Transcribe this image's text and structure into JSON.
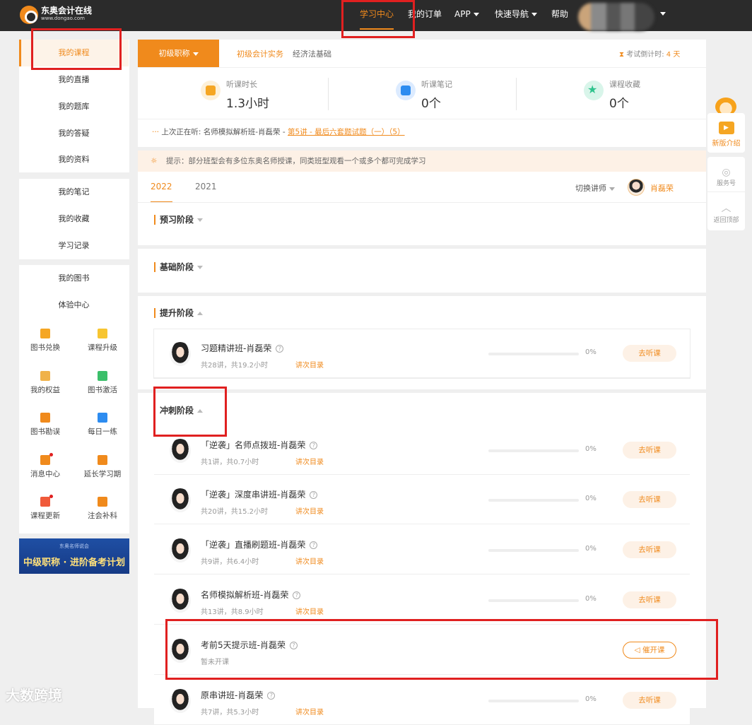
{
  "brand": {
    "name": "东奥会计在线",
    "url": "www.dongao.com"
  },
  "topnav": {
    "items": [
      "学习中心",
      "我的订单",
      "APP",
      "快速导航",
      "帮助"
    ]
  },
  "sidebar": {
    "group1": [
      "我的课程",
      "我的直播",
      "我的题库",
      "我的答疑",
      "我的资料"
    ],
    "group2": [
      "我的笔记",
      "我的收藏",
      "学习记录"
    ],
    "group3": [
      "我的图书",
      "体验中心"
    ],
    "grid": [
      {
        "label": "图书兑换",
        "icon": "exchange-icon",
        "color": "#f5a623"
      },
      {
        "label": "课程升级",
        "icon": "upgrade-icon",
        "color": "#f7c531"
      },
      {
        "label": "我的权益",
        "icon": "crown-icon",
        "color": "#f0b24a"
      },
      {
        "label": "图书激活",
        "icon": "book-activate-icon",
        "color": "#3bbf6a"
      },
      {
        "label": "图书勘误",
        "icon": "book-errata-icon",
        "color": "#f08a1c"
      },
      {
        "label": "每日一练",
        "icon": "daily-practice-icon",
        "color": "#2d8cf0"
      },
      {
        "label": "消息中心",
        "icon": "bell-icon",
        "color": "#f08a1c"
      },
      {
        "label": "延长学习期",
        "icon": "calendar-icon",
        "color": "#f08a1c"
      },
      {
        "label": "课程更新",
        "icon": "play-icon",
        "color": "#f05a3a"
      },
      {
        "label": "注会补科",
        "icon": "briefcase-icon",
        "color": "#f08a1c"
      }
    ],
    "banner": {
      "small": "东奥名师说会",
      "big": "中级职称 · 进阶备考计划"
    }
  },
  "course_tabs": {
    "active": "初级职称",
    "others": [
      "初级会计实务",
      "经济法基础"
    ]
  },
  "countdown": {
    "label": "考试倒计时:",
    "value": "4 天"
  },
  "stats": [
    {
      "label": "听课时长",
      "value": "1.3小时",
      "color": "#f5a623"
    },
    {
      "label": "听课笔记",
      "value": "0个",
      "color": "#2d8cf0"
    },
    {
      "label": "课程收藏",
      "value": "0个",
      "color": "#2fc38d"
    }
  ],
  "last_watch": {
    "prefix": "上次正在听:",
    "course": "名师模拟解析班-肖磊荣 -",
    "link": "第5讲 - 最后六套题试题（一）（5）"
  },
  "tip": "提示：部分班型会有多位东奥名师授课，同类班型观看一个或多个都可完成学习",
  "years": [
    "2022",
    "2021"
  ],
  "teacher_switch": {
    "label": "切换讲师",
    "name": "肖磊荣"
  },
  "sections": [
    "预习阶段",
    "基础阶段",
    "提升阶段",
    "冲刺阶段"
  ],
  "directory_label": "讲次目录",
  "go_label": "去听课",
  "remind_label": "催开课",
  "courses_improve": [
    {
      "title": "习题精讲班-肖磊荣",
      "meta": "共28讲，共19.2小时",
      "progress": "0%"
    }
  ],
  "courses_sprint": [
    {
      "title": "「逆袭」名师点拨班-肖磊荣",
      "meta": "共1讲，共0.7小时",
      "progress": "0%"
    },
    {
      "title": "「逆袭」深度串讲班-肖磊荣",
      "meta": "共20讲，共15.2小时",
      "progress": "0%"
    },
    {
      "title": "「逆袭」直播刷题班-肖磊荣",
      "meta": "共9讲，共6.4小时",
      "progress": "0%"
    },
    {
      "title": "名师模拟解析班-肖磊荣",
      "meta": "共13讲，共8.9小时",
      "progress": "0%"
    },
    {
      "title": "考前5天提示班-肖磊荣",
      "meta": "暂未开课",
      "progress": ""
    },
    {
      "title": "原串讲班-肖磊荣",
      "meta": "共7讲，共5.3小时",
      "progress": "0%"
    }
  ],
  "float": {
    "intro": "新版介绍",
    "service": "服务号",
    "top": "返回顶部"
  },
  "watermark": "大数跨境"
}
